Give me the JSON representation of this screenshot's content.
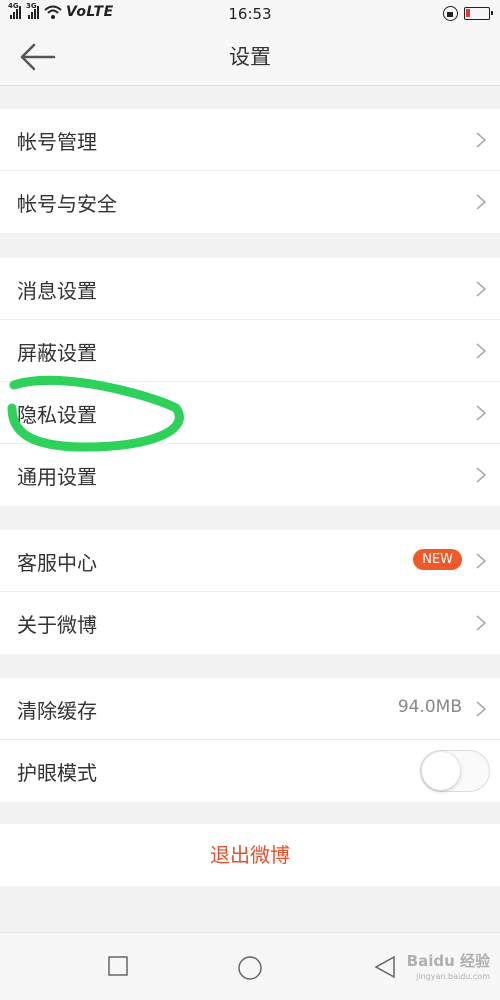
{
  "status_bar": {
    "network_tags": [
      "4G",
      "3G"
    ],
    "carrier": "VoLTE",
    "time": "16:53"
  },
  "header": {
    "title": "设置",
    "back_icon": "arrow-left-icon"
  },
  "groups": [
    {
      "items": [
        {
          "label": "帐号管理"
        },
        {
          "label": "帐号与安全"
        }
      ]
    },
    {
      "items": [
        {
          "label": "消息设置"
        },
        {
          "label": "屏蔽设置"
        },
        {
          "label": "隐私设置"
        },
        {
          "label": "通用设置"
        }
      ]
    },
    {
      "items": [
        {
          "label": "客服中心",
          "badge": "NEW"
        },
        {
          "label": "关于微博"
        }
      ]
    },
    {
      "items": [
        {
          "label": "清除缓存",
          "value": "94.0MB"
        },
        {
          "label": "护眼模式",
          "toggle": false
        }
      ]
    }
  ],
  "logout": {
    "label": "退出微博"
  },
  "nav_bar": {
    "icons": [
      "square-recents-icon",
      "circle-home-icon",
      "triangle-back-icon"
    ]
  },
  "watermark": {
    "brand": "Baidu 经验",
    "url": "jingyan.baidu.com"
  },
  "colors": {
    "accent": "#e4512b",
    "badge": "#f05a28",
    "annotation": "#2ed15a"
  }
}
